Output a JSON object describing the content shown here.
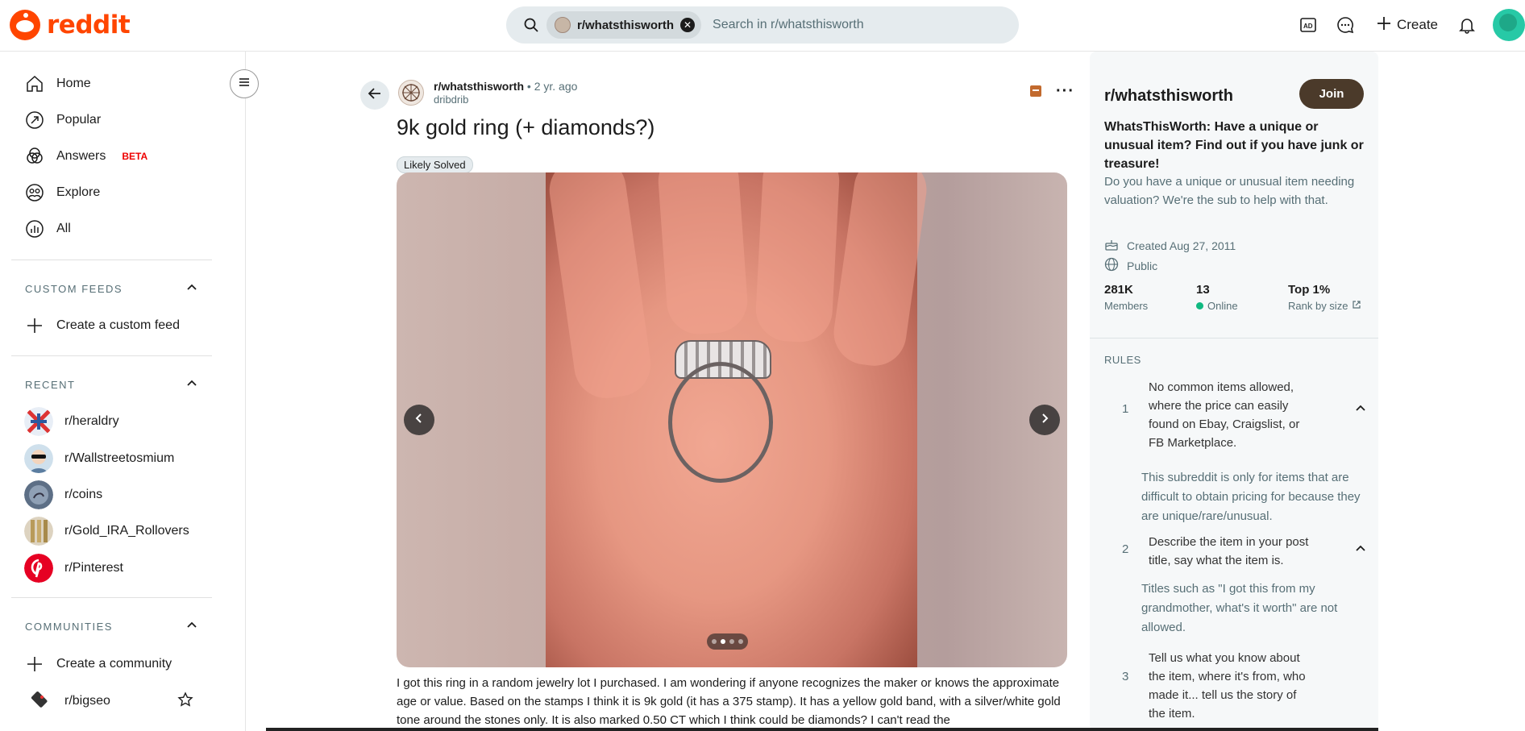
{
  "header": {
    "logo_text": "reddit",
    "search_chip": "r/whatsthisworth",
    "search_placeholder": "Search in r/whatsthisworth",
    "create_label": "Create"
  },
  "sidebar": {
    "nav": [
      {
        "label": "Home",
        "icon": "home-icon"
      },
      {
        "label": "Popular",
        "icon": "popular-icon"
      },
      {
        "label": "Answers",
        "icon": "answers-icon",
        "badge": "BETA"
      },
      {
        "label": "Explore",
        "icon": "explore-icon"
      },
      {
        "label": "All",
        "icon": "all-icon"
      }
    ],
    "custom_feeds_header": "CUSTOM FEEDS",
    "create_custom_feed": "Create a custom feed",
    "recent_header": "RECENT",
    "recent": [
      {
        "label": "r/heraldry"
      },
      {
        "label": "r/Wallstreetosmium"
      },
      {
        "label": "r/coins"
      },
      {
        "label": "r/Gold_IRA_Rollovers"
      },
      {
        "label": "r/Pinterest"
      }
    ],
    "communities_header": "COMMUNITIES",
    "create_community": "Create a community",
    "communities": [
      {
        "label": "r/bigseo"
      }
    ]
  },
  "post": {
    "subreddit": "r/whatsthisworth",
    "time": "• 2 yr. ago",
    "author": "dribdrib",
    "title": "9k gold ring (+ diamonds?)",
    "flair": "Likely Solved",
    "gallery_total": 4,
    "gallery_active": 2,
    "body": "I got this ring in a random jewelry lot I purchased. I am wondering if anyone recognizes the maker or knows the approximate age or value. Based on the stamps I think it is 9k gold (it has a 375 stamp). It has a yellow gold band, with a silver/white gold tone around the stones only. It is also marked 0.50 CT which I think could be diamonds? I can't read the"
  },
  "community": {
    "name": "r/whatsthisworth",
    "join_label": "Join",
    "tagline": "WhatsThisWorth: Have a unique or unusual item? Find out if you have junk or treasure!",
    "description": "Do you have a unique or unusual item needing valuation? We're the sub to help with that.",
    "created": "Created Aug 27, 2011",
    "visibility": "Public",
    "stats": [
      {
        "value": "281K",
        "label": "Members"
      },
      {
        "value": "13",
        "label": "Online"
      },
      {
        "value": "Top 1%",
        "label": "Rank by size"
      }
    ],
    "rules_header": "RULES",
    "rules": [
      {
        "num": "1",
        "title": "No common items allowed, where the price can easily found on Ebay, Craigslist, or FB Marketplace.",
        "desc": "This subreddit is only for items that are difficult to obtain pricing for because they are unique/rare/unusual."
      },
      {
        "num": "2",
        "title": "Describe the item in your post title, say what the item is.",
        "desc": "Titles such as \"I got this from my grandmother, what's it worth\" are not allowed."
      },
      {
        "num": "3",
        "title": "Tell us what you know about the item, where it's from, who made it... tell us the story of the item.",
        "desc": ""
      }
    ]
  },
  "colors": {
    "brand": "#ff4500",
    "join": "#4b3a2a",
    "online": "#10b981"
  }
}
